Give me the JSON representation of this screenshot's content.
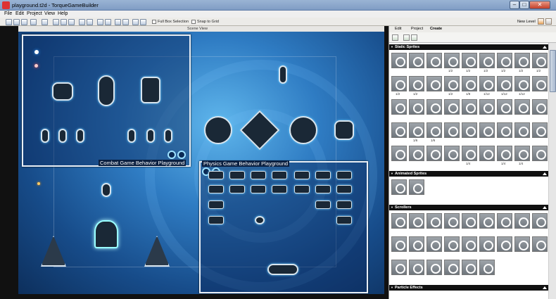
{
  "window": {
    "title": "playground.t2d - TorqueGameBuilder"
  },
  "menu": [
    "File",
    "Edit",
    "Project",
    "View",
    "Help"
  ],
  "toolbar": {
    "full_box_selection": "Full Box Selection",
    "snap_to_grid": "Snap to Grid",
    "new_level": "New Level"
  },
  "scene": {
    "title": "Scene View"
  },
  "panels": {
    "combat": "Combat Game Behavior Playground",
    "physics": "Physics Game Behavior Playground"
  },
  "rightpanel": {
    "tabs": [
      "Edit",
      "Project",
      "Create"
    ],
    "sections": {
      "static": "Static Sprites",
      "animated": "Animated Sprites",
      "scrollers": "Scrollers",
      "particles": "Particle Effects"
    },
    "badges": {
      "half": "1/2",
      "twelfth": "1/12",
      "eighth": "1/8",
      "sixth": "1/6",
      "fourth": "1/4"
    }
  }
}
